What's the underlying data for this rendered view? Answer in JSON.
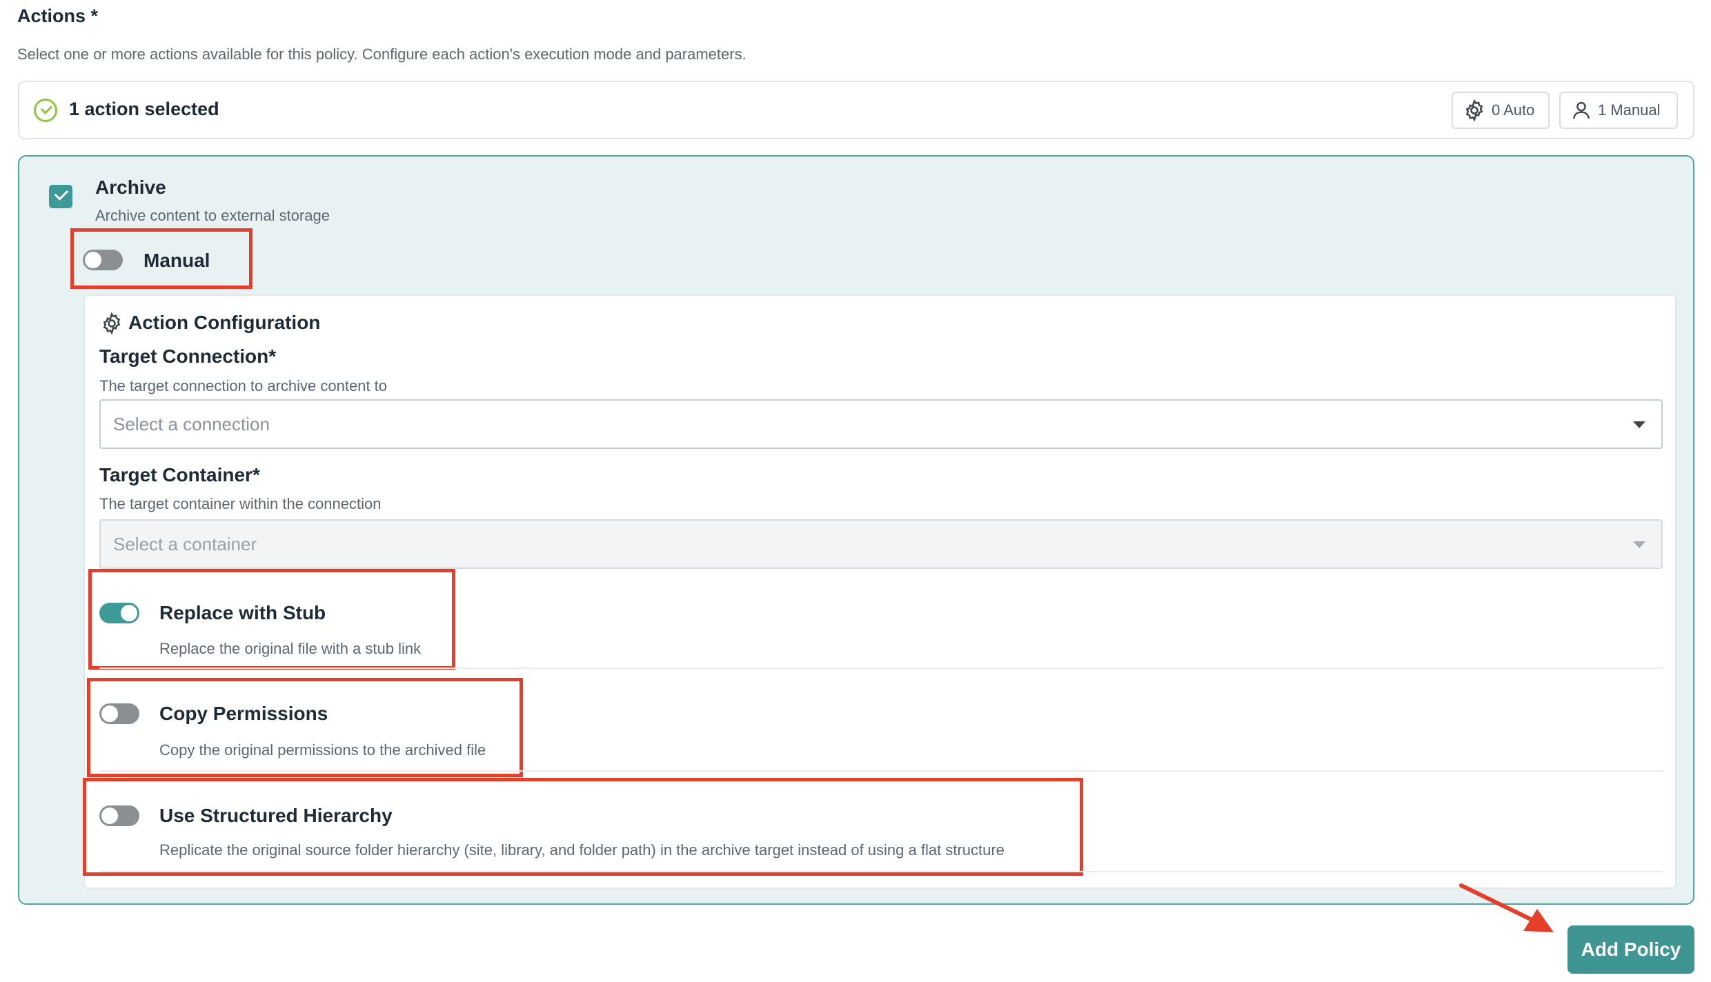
{
  "section": {
    "title": "Actions *",
    "description": "Select one or more actions available for this policy. Configure each action's execution mode and parameters."
  },
  "summary": {
    "selected_text": "1 action selected",
    "auto_chip": "0 Auto",
    "manual_chip": "1 Manual"
  },
  "action": {
    "name": "Archive",
    "description": "Archive content to external storage",
    "checked": true,
    "mode_toggle": {
      "label": "Manual",
      "on": false
    }
  },
  "config": {
    "title": "Action Configuration",
    "target_connection": {
      "label": "Target Connection*",
      "help": "The target connection to archive content to",
      "placeholder": "Select a connection"
    },
    "target_container": {
      "label": "Target Container*",
      "help": "The target container within the connection",
      "placeholder": "Select a container"
    },
    "options": [
      {
        "label": "Replace with Stub",
        "description": "Replace the original file with a stub link",
        "on": true
      },
      {
        "label": "Copy Permissions",
        "description": "Copy the original permissions to the archived file",
        "on": false
      },
      {
        "label": "Use Structured Hierarchy",
        "description": "Replicate the original source folder hierarchy (site, library, and folder path) in the archive target instead of using a flat structure",
        "on": false
      }
    ]
  },
  "footer": {
    "add_policy_label": "Add Policy"
  },
  "colors": {
    "accent": "#3d9a97",
    "highlight": "#e53e2b",
    "success": "#8dc63f"
  }
}
